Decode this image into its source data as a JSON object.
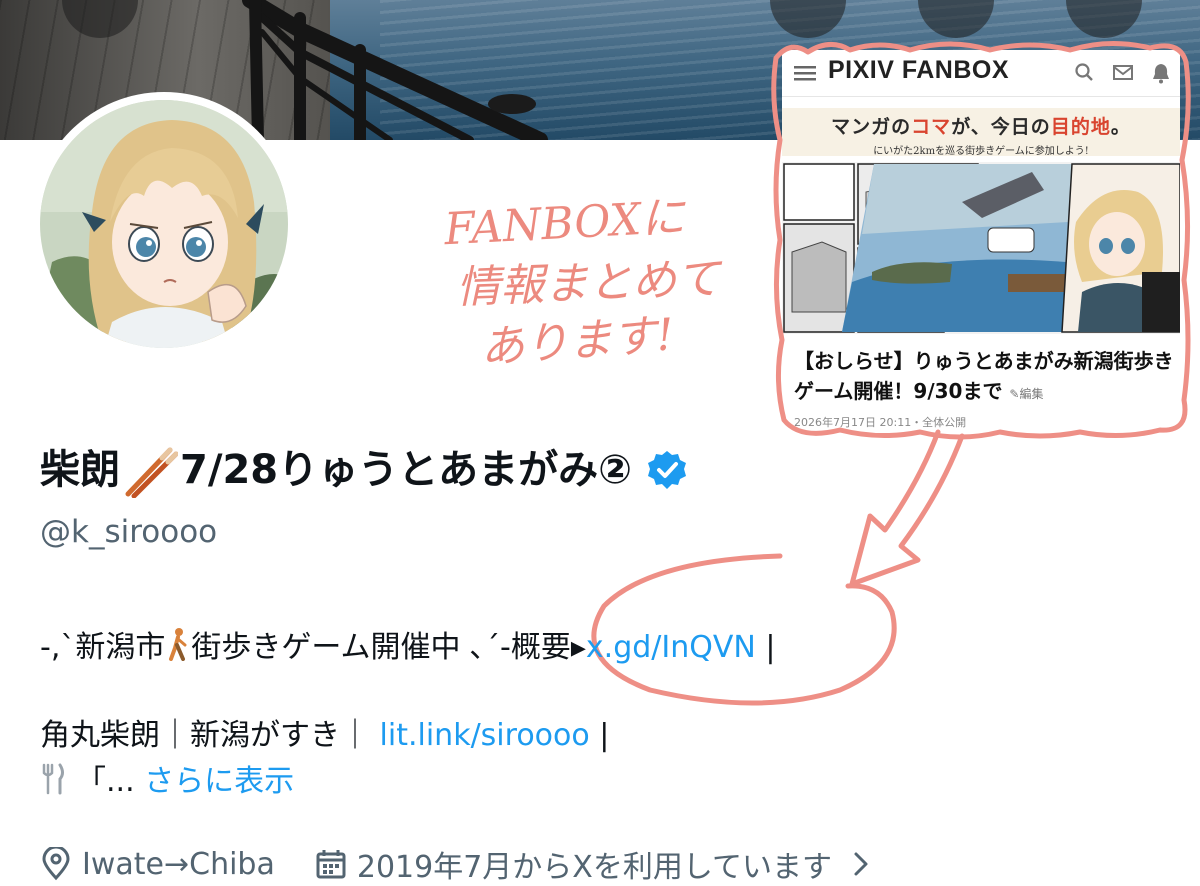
{
  "note": {
    "line1": "FANBOXに",
    "line2": "情報まとめて",
    "line3": "あります!"
  },
  "fanbox": {
    "logo": "PIXIV FANBOX",
    "banner_title_a": "マンガの",
    "banner_title_b": "コマ",
    "banner_title_c": "が、今日の",
    "banner_title_d": "目的地",
    "banner_title_e": "。",
    "banner_subtitle": "にいがた2kmを巡る街歩きゲームに参加しよう!",
    "post_title": "【おしらせ】りゅうとあまがみ新潟街歩きゲーム開催！9/30まで",
    "edit_label": "✎編集",
    "date": "2026年7月17日 20:11・全体公開"
  },
  "profile": {
    "name_prefix": "柴朗",
    "name_suffix": "7/28りゅうとあまがみ②",
    "handle": "@k_siroooo",
    "bio1_prefix": "-,`新潟市",
    "bio1_mid": "街歩きゲーム開催中 ､´-概要▸",
    "bio1_link": "x.gd/InQVN",
    "bio1_suffix": " |",
    "bio2_prefix": "角丸柴朗｜新潟がすき｜ ",
    "bio2_link": "lit.link/siroooo",
    "bio2_suffix": " |",
    "bio3_prefix": "「... ",
    "bio3_link": "さらに表示",
    "location": "Iwate→Chiba",
    "joined": "2019年7月からXを利用しています"
  },
  "colors": {
    "link": "#1d9bf0",
    "annotation": "#ec8a7f",
    "verified": "#1d9bf0",
    "muted": "#536471"
  },
  "icons": [
    "menu-icon",
    "search-icon",
    "mail-icon",
    "bell-icon",
    "verified-badge-icon",
    "chopsticks-icon",
    "walking-person-icon",
    "cutlery-icon",
    "location-pin-icon",
    "calendar-icon",
    "chevron-right-icon"
  ]
}
